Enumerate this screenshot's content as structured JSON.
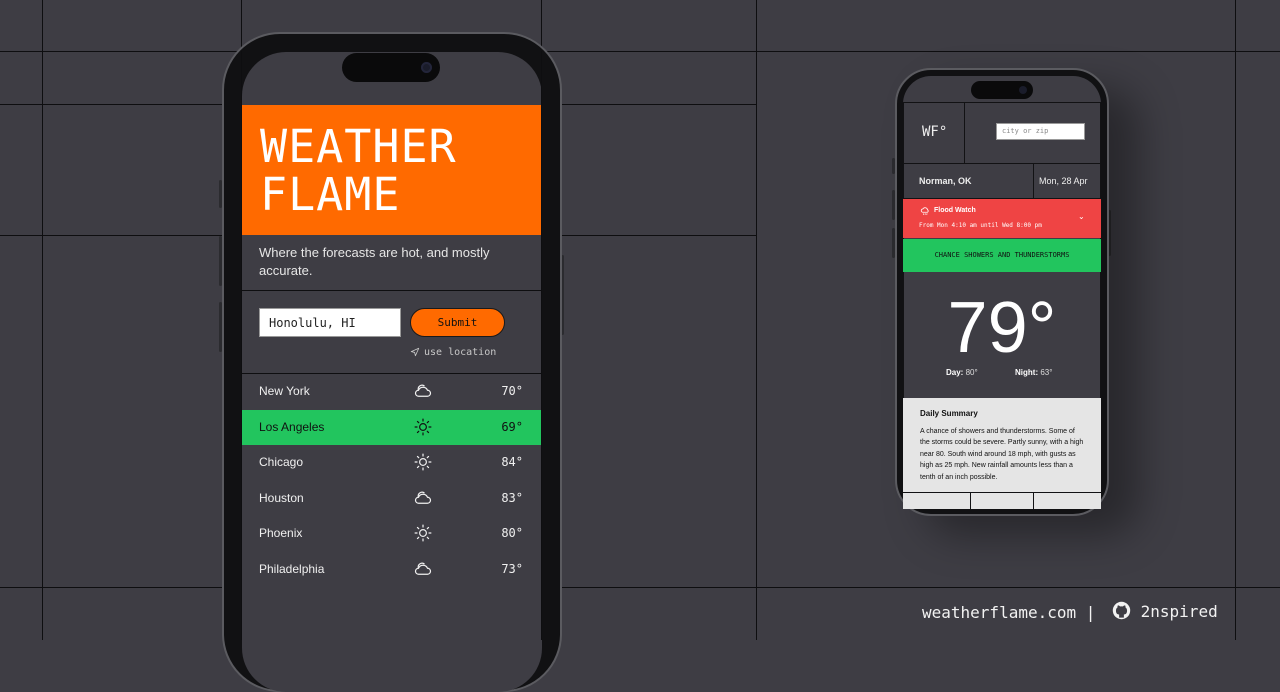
{
  "brand": {
    "title": "WEATHER\nFLAME",
    "tagline": "Where the forecasts are hot, and mostly accurate."
  },
  "search": {
    "value": "Honolulu, HI",
    "submit_label": "Submit",
    "use_location_label": "use location"
  },
  "cities": [
    {
      "name": "New York",
      "icon": "partly-cloudy-icon",
      "temp": "70°"
    },
    {
      "name": "Los Angeles",
      "icon": "sun-icon",
      "temp": "69°"
    },
    {
      "name": "Chicago",
      "icon": "sun-icon",
      "temp": "84°"
    },
    {
      "name": "Houston",
      "icon": "partly-cloudy-icon",
      "temp": "83°"
    },
    {
      "name": "Phoenix",
      "icon": "sun-icon",
      "temp": "80°"
    },
    {
      "name": "Philadelphia",
      "icon": "partly-cloudy-icon",
      "temp": "73°"
    }
  ],
  "detail": {
    "logo": "WF°",
    "search_placeholder": "city or zip",
    "location": "Norman, OK",
    "date": "Mon, 28 Apr",
    "alert_title": "Flood Watch",
    "alert_time": "From Mon 4:10 am until Wed 8:00 pm",
    "condition": "CHANCE SHOWERS AND THUNDERSTORMS",
    "temperature": "79°",
    "day_label": "Day:",
    "day_temp": "80°",
    "night_label": "Night:",
    "night_temp": "63°",
    "summary_title": "Daily Summary",
    "summary_text": "A chance of showers and thunderstorms. Some of the storms could be severe. Partly sunny, with a high near 80. South wind around 18 mph, with gusts as high as 25 mph. New rainfall amounts less than a tenth of an inch possible."
  },
  "footer": {
    "site": "weatherflame.com",
    "separator": "|",
    "author": "2nspired"
  },
  "colors": {
    "accent": "#ff6a00",
    "highlight": "#22c55e",
    "alert": "#ef4444",
    "background": "#3e3d44"
  }
}
